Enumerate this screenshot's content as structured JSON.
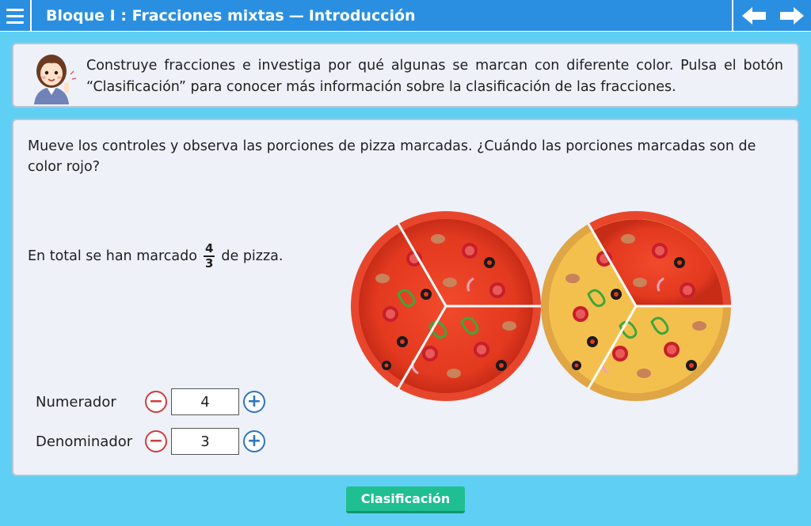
{
  "header": {
    "block": "Bloque I : Fracciones mixtas",
    "separator": "—",
    "section": "Introducción"
  },
  "instructions": {
    "text": "Construye fracciones e investiga por qué algunas se marcan con diferente color. Pulsa el botón “Clasificación” para conocer más información sobre la clasificación de las fracciones."
  },
  "question": {
    "text": "Mueve los controles y observa las porciones de pizza marcadas. ¿Cuándo las porciones marcadas son de color rojo?"
  },
  "total": {
    "prefix": "En total se han marcado",
    "numerator": "4",
    "denominator": "3",
    "suffix": "de pizza."
  },
  "pizzas": {
    "count": 2,
    "slices_per_pizza": 3,
    "marked_slices": 4,
    "marked_color": "#e8462c"
  },
  "controls": {
    "numerator": {
      "label": "Numerador",
      "value": "4"
    },
    "denominator": {
      "label": "Denominador",
      "value": "3"
    },
    "minus_symbol": "−",
    "plus_symbol": "+"
  },
  "classify_button": {
    "label": "Clasificación"
  },
  "colors": {
    "header": "#2a8fe0",
    "background": "#5fd0f3",
    "panel": "#eef1f8",
    "button": "#1fbf92",
    "minus": "#cf3d3d",
    "plus": "#2f75c0"
  }
}
